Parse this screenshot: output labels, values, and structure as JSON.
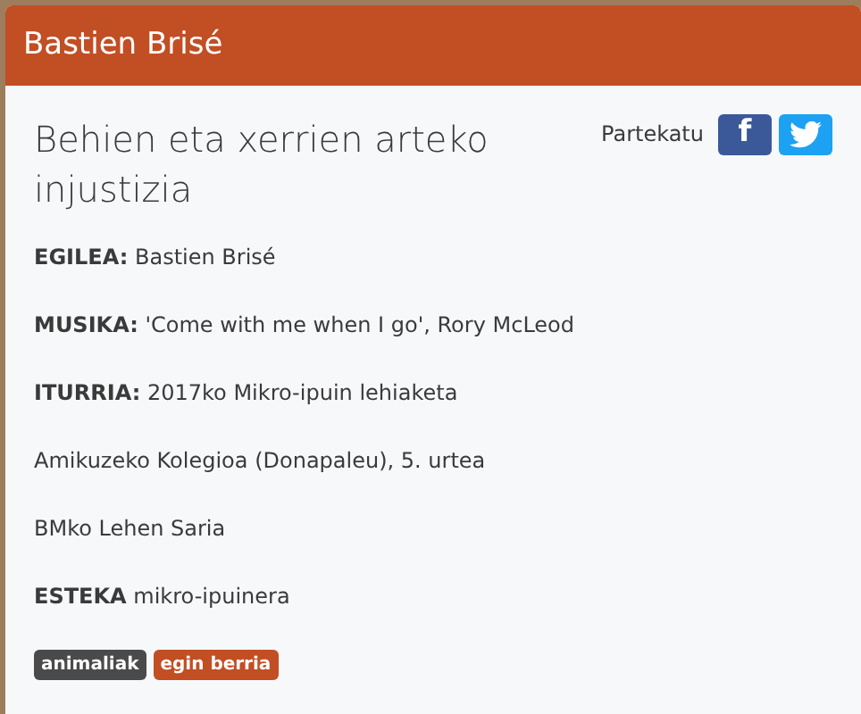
{
  "header": {
    "title": "Bastien Brisé"
  },
  "article": {
    "title": "Behien eta xerrien arteko injustizia",
    "share": {
      "label": "Partekatu",
      "buttons": [
        {
          "kind": "facebook",
          "glyph": "f"
        },
        {
          "kind": "twitter"
        }
      ]
    },
    "lines": [
      "**EGILEA:** Bastien Brisé",
      "**MUSIKA:** 'Come with me when I go', Rory McLeod",
      "**ITURRIA:** 2017ko Mikro-ipuin lehiaketa",
      "Amikuzeko Kolegioa (Donapaleu), 5. urtea",
      "BMko Lehen Saria",
      "**ESTEKA** mikro-ipuinera"
    ],
    "tags": [
      {
        "label": "animaliak",
        "color": "#4a4a4a"
      },
      {
        "label": "egin berria",
        "color": "#c24e24"
      }
    ]
  }
}
